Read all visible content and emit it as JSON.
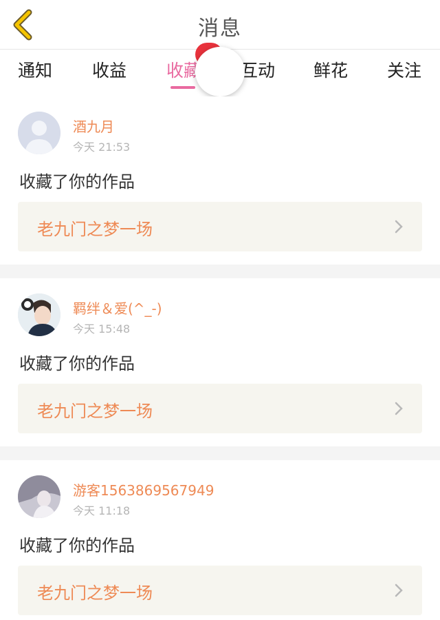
{
  "header": {
    "title": "消息",
    "back_icon": "chevron-left-icon",
    "back_color": "#f5b800"
  },
  "tabs": [
    {
      "label": "通知",
      "active": false
    },
    {
      "label": "收益",
      "active": false
    },
    {
      "label": "收藏",
      "active": true
    },
    {
      "label": "互动",
      "active": false
    },
    {
      "label": "鲜花",
      "active": false
    },
    {
      "label": "关注",
      "active": false
    }
  ],
  "colors": {
    "accent": "#e96aa0",
    "name": "#ee8a55",
    "work_bg": "#f6f5ef",
    "badge_red": "#e8323c"
  },
  "feed": [
    {
      "user": "酒九月",
      "time": "今天 21:53",
      "action": "收藏了你的作品",
      "work": "老九门之梦一场",
      "avatar": "default-avatar-icon"
    },
    {
      "user": "羁绊＆爱(^_-)",
      "time": "今天 15:48",
      "action": "收藏了你的作品",
      "work": "老九门之梦一场",
      "avatar": "user-photo-avatar"
    },
    {
      "user": "游客1563869567949",
      "time": "今天 11:18",
      "action": "收藏了你的作品",
      "work": "老九门之梦一场",
      "avatar": "user-photo-avatar"
    }
  ]
}
